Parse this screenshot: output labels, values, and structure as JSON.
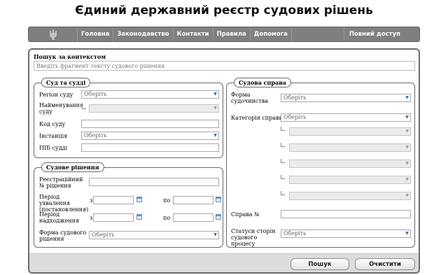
{
  "header": {
    "title": "Єдиний державний реєстр судових рішень"
  },
  "nav": {
    "logo_icon": "trident-icon",
    "items": [
      "Головна",
      "Законодавство",
      "Контакти",
      "Правила",
      "Допомога"
    ],
    "full_access": "Повний доступ"
  },
  "search": {
    "label": "Пошук за контекстом",
    "placeholder": "Введіть фрагмент тексту судового рішення"
  },
  "court": {
    "legend": "Суд та судді",
    "region_label": "Регіон суду",
    "region_value": "Оберіть",
    "name_label": "Найменування суду",
    "code_label": "Код суду",
    "instance_label": "Інстанція",
    "instance_value": "Оберіть",
    "judge_label": "ПІБ судді"
  },
  "decision": {
    "legend": "Судове рішення",
    "reg_no_label": "Реєстраційний № рішення",
    "adopt_period_label": "Період ухвалення (постановлення)",
    "receipt_period_label": "Період надходження",
    "from": "з",
    "to": "по",
    "form_label": "Форма судового рішення",
    "form_value": "Оберіть"
  },
  "case": {
    "legend": "Судова справа",
    "proceeding_form_label": "Форма судочинства",
    "proceeding_form_value": "Оберіть",
    "category_label": "Категорія справи",
    "category_value": "Оберіть",
    "case_no_label": "Справа №",
    "parties_status_label": "Статуси сторін судового процесу",
    "parties_status_value": "Оберіть"
  },
  "actions": {
    "search": "Пошук",
    "clear": "Очистити"
  },
  "colors": {
    "nav_bg": "#7f7f7f",
    "frame": "#6b6b6b",
    "footer_bg": "#dcdcdc",
    "accent": "#3a66b0"
  }
}
